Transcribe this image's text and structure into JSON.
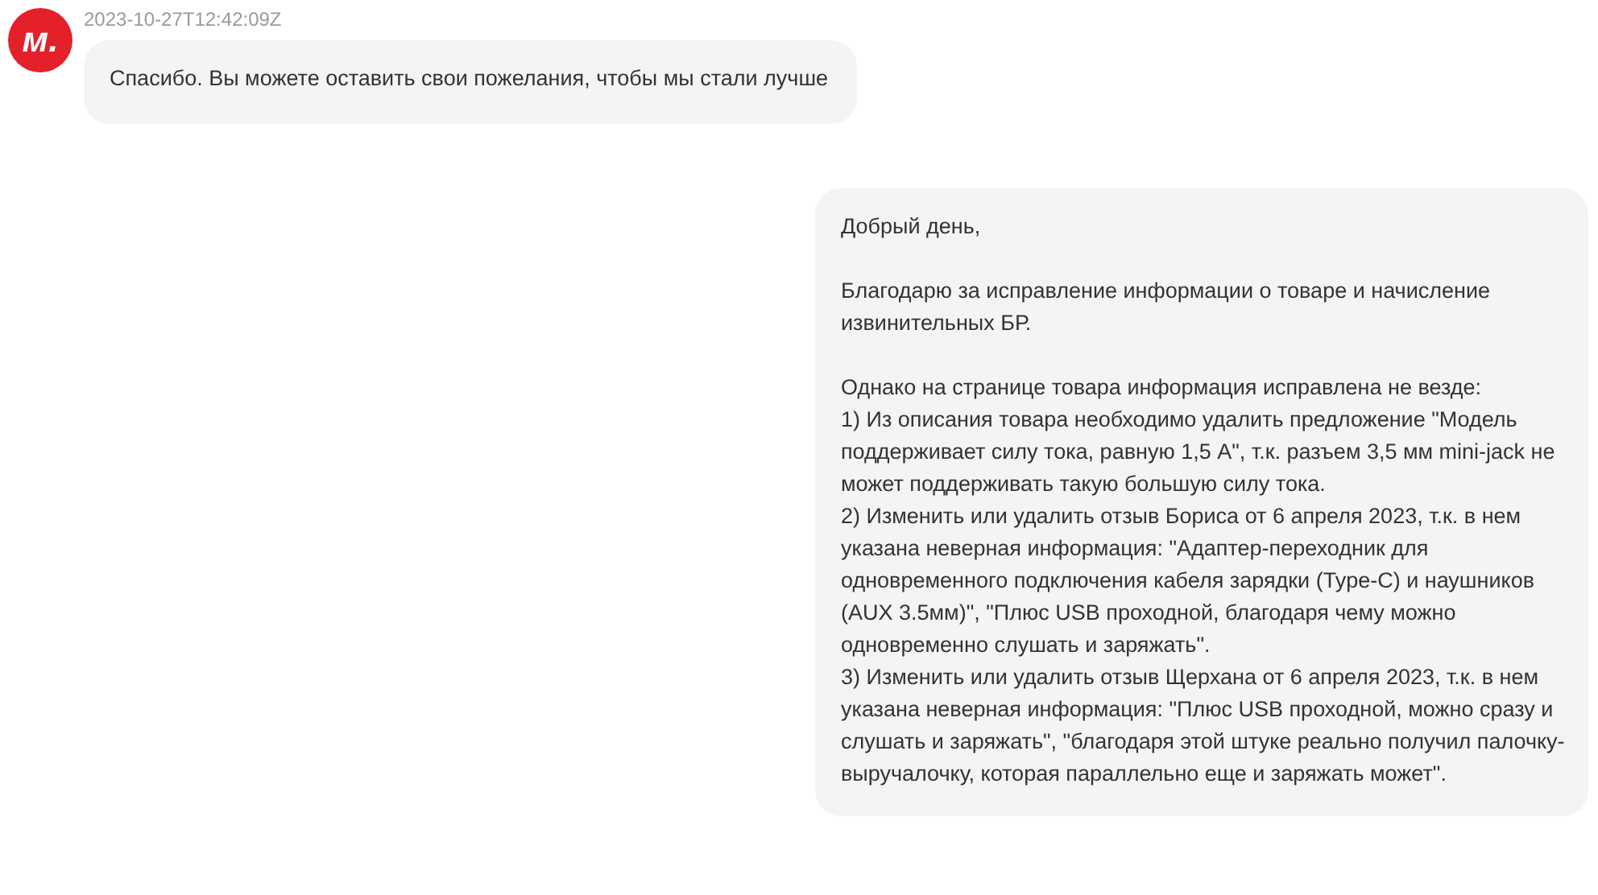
{
  "messages": [
    {
      "kind": "incoming",
      "avatar": {
        "label": "м."
      },
      "timestamp": "2023-10-27T12:42:09Z",
      "paragraphs": [
        [
          "Спасибо. Вы можете оставить свои пожелания, чтобы мы стали лучше"
        ]
      ]
    },
    {
      "kind": "outgoing",
      "paragraphs": [
        [
          "Добрый день,"
        ],
        [
          "Благодарю за исправление информации о товаре и начисление извинительных БР."
        ],
        [
          "Однако на странице товара информация исправлена не везде:",
          "1) Из описания товара необходимо удалить предложение \"Модель поддерживает силу тока, равную 1,5 А\", т.к. разъем 3,5 мм mini-jack не может поддерживать такую большую силу тока.",
          "2) Изменить или удалить отзыв Бориса от 6 апреля 2023, т.к. в нем указана неверная информация: \"Адаптер-переходник для одновременного подключения кабеля зарядки (Type-C) и наушников (AUX 3.5мм)\", \"Плюс USB проходной, благодаря чему можно одновременно слушать и заряжать\".",
          "3) Изменить или удалить отзыв Щерхана от 6 апреля 2023, т.к. в нем указана неверная информация: \"Плюс USB проходной, можно сразу и слушать и заряжать\", \"благодаря этой штуке реально получил палочку-выручалочку, которая параллельно еще и заряжать может\"."
        ]
      ]
    }
  ]
}
